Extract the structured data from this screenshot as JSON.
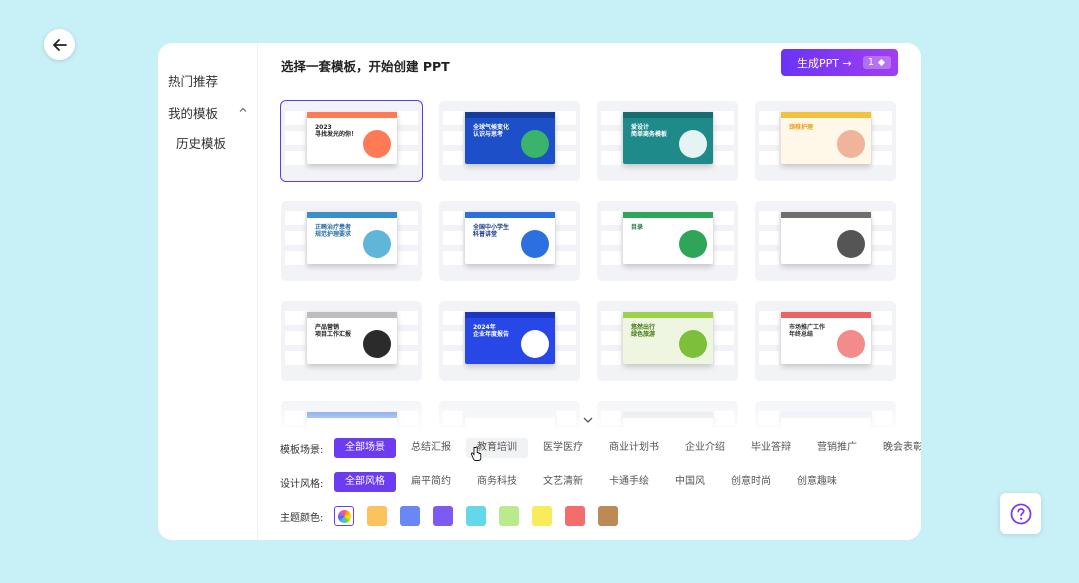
{
  "sidebar": {
    "hot": "热门推荐",
    "mine": "我的模板",
    "history": "历史模板"
  },
  "header": {
    "title": "选择一套模板，开始创建 PPT",
    "generate_label": "生成PPT →",
    "generate_count": "1"
  },
  "templates": [
    {
      "title": "2023\n寻找发光的你！",
      "bg": "#ffffff",
      "accent": "#ff7a55",
      "bar": "#ff7a55",
      "text": "#222"
    },
    {
      "title": "全球气候变化\n认识与思考",
      "bg": "#1d4fc8",
      "accent": "#39b46a",
      "bar": "#143b9e",
      "text": "#fff"
    },
    {
      "title": "爱设计\n简单商务模板",
      "bg": "#1f8a8a",
      "accent": "#e6f3f3",
      "bar": "#176e6e",
      "text": "#fff"
    },
    {
      "title": "颈椎护理",
      "bg": "#fff7e8",
      "accent": "#f0b49a",
      "bar": "#f3c140",
      "text": "#e7a21b"
    },
    {
      "title": "正畸治疗患者\n规范护理要求",
      "bg": "#ffffff",
      "accent": "#5fb6d8",
      "bar": "#3a8fc6",
      "text": "#2a6ea6"
    },
    {
      "title": "全国中小学生\n科普讲堂",
      "bg": "#ffffff",
      "accent": "#2c6fe0",
      "bar": "#2c6fe0",
      "text": "#1a3b8c"
    },
    {
      "title": "目录",
      "bg": "#ffffff",
      "accent": "#2fa55a",
      "bar": "#2fa55a",
      "text": "#1f7a3e"
    },
    {
      "title": "",
      "bg": "#ffffff",
      "accent": "#555555",
      "bar": "#6e6e6e",
      "text": "#333"
    },
    {
      "title": "产品营销\n项目工作汇报",
      "bg": "#ffffff",
      "accent": "#2b2b2b",
      "bar": "#bdbdbd",
      "text": "#222"
    },
    {
      "title": "2024年\n企业年度报告",
      "bg": "#2747e6",
      "accent": "#ffffff",
      "bar": "#1c36c2",
      "text": "#fff"
    },
    {
      "title": "悠然出行\n绿色旅游",
      "bg": "#eef5e0",
      "accent": "#7cbf3a",
      "bar": "#9bd14b",
      "text": "#3f7a12"
    },
    {
      "title": "市场推广工作\n年终总结",
      "bg": "#ffffff",
      "accent": "#f28b8b",
      "bar": "#f06262",
      "text": "#333"
    },
    {
      "title": "",
      "bg": "#ffffff",
      "accent": "#3f7be8",
      "bar": "#3f7be8",
      "text": "#333"
    },
    {
      "title": "",
      "bg": "#ffffff",
      "accent": "#f08a6a",
      "bar": "#f0f0f0",
      "text": "#333"
    },
    {
      "title": "",
      "bg": "#ffffff",
      "accent": "#333333",
      "bar": "#e0e0e0",
      "text": "#333"
    },
    {
      "title": "",
      "bg": "#ffffff",
      "accent": "#4d7de8",
      "bar": "#e3e8f5",
      "text": "#333"
    }
  ],
  "filters": {
    "scene_label": "模板场景:",
    "scenes": [
      "全部场景",
      "总结汇报",
      "教育培训",
      "医学医疗",
      "商业计划书",
      "企业介绍",
      "毕业答辩",
      "营销推广",
      "晚会表彰"
    ],
    "style_label": "设计风格:",
    "styles": [
      "全部风格",
      "扁平简约",
      "商务科技",
      "文艺清新",
      "卡通手绘",
      "中国风",
      "创意时尚",
      "创意趣味"
    ],
    "color_label": "主题颜色:",
    "colors": [
      "#fbc35c",
      "#6b86f5",
      "#7f5af0",
      "#62d8ea",
      "#b9ea8c",
      "#f8ec5a",
      "#f46d6d",
      "#bd8a55"
    ]
  },
  "icons": {
    "back": "arrow-left-icon",
    "help": "question-circle-icon",
    "expand": "chevron-down-icon",
    "diamond": "diamond-icon"
  },
  "accent_color": "#6c3cf0"
}
